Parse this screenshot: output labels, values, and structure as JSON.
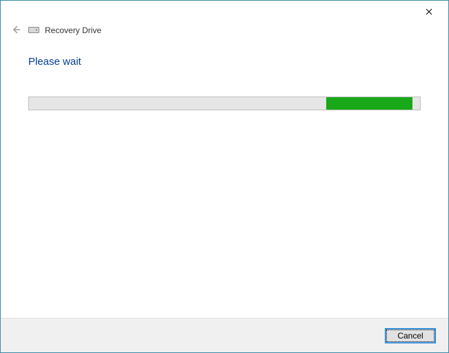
{
  "header": {
    "title": "Recovery Drive"
  },
  "content": {
    "heading": "Please wait",
    "progress": {
      "start_percent": 76,
      "end_percent": 98
    }
  },
  "footer": {
    "cancel_label": "Cancel"
  }
}
